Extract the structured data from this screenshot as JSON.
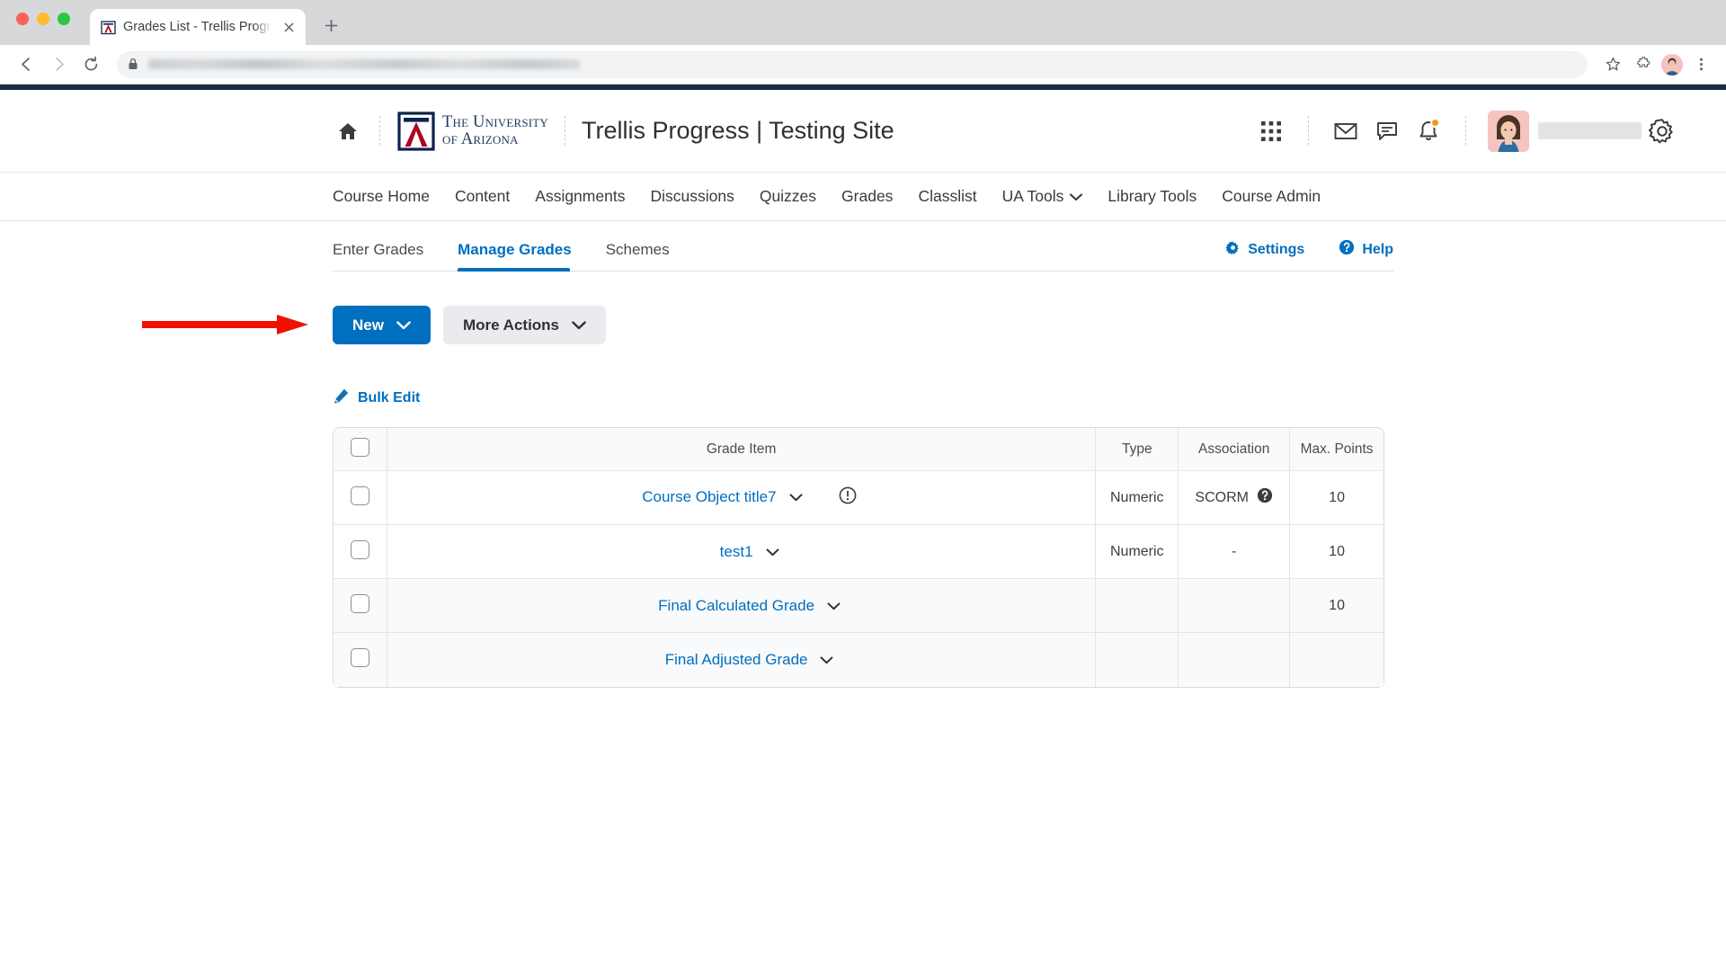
{
  "browser": {
    "tab_title": "Grades List - Trellis Progress |",
    "tab_favicon": "arizona-a-icon",
    "new_tab_label": "+",
    "close_label": "×",
    "back_icon": "back-arrow-icon",
    "forward_icon": "forward-arrow-icon",
    "reload_icon": "reload-icon",
    "lock_icon": "lock-icon",
    "url_value": "",
    "bookmark_icon": "star-icon",
    "extensions_icon": "puzzle-piece-icon",
    "profile_icon": "profile-avatar-icon",
    "menu_icon": "kebab-menu-icon",
    "window_menu_icon": "chevron-circle-icon"
  },
  "header": {
    "home_icon": "home-icon",
    "logo_line1": "The University",
    "logo_line2": "of Arizona",
    "site_title": "Trellis Progress | Testing Site",
    "icons": [
      {
        "name": "waffle-grid-icon",
        "label": "Course Selector"
      },
      {
        "name": "envelope-icon",
        "label": "Email"
      },
      {
        "name": "chat-icon",
        "label": "Chat"
      },
      {
        "name": "bell-icon",
        "label": "Notifications",
        "has_badge": true
      },
      {
        "name": "gear-icon",
        "label": "Settings"
      }
    ],
    "user_name": ""
  },
  "nav": {
    "items": [
      {
        "label": "Course Home",
        "has_chevron": false
      },
      {
        "label": "Content",
        "has_chevron": false
      },
      {
        "label": "Assignments",
        "has_chevron": false
      },
      {
        "label": "Discussions",
        "has_chevron": false
      },
      {
        "label": "Quizzes",
        "has_chevron": false
      },
      {
        "label": "Grades",
        "has_chevron": false
      },
      {
        "label": "Classlist",
        "has_chevron": false
      },
      {
        "label": "UA Tools",
        "has_chevron": true
      },
      {
        "label": "Library Tools",
        "has_chevron": false
      },
      {
        "label": "Course Admin",
        "has_chevron": false
      }
    ]
  },
  "tabs": {
    "items": [
      {
        "label": "Enter Grades",
        "active": false
      },
      {
        "label": "Manage Grades",
        "active": true
      },
      {
        "label": "Schemes",
        "active": false
      }
    ],
    "settings_label": "Settings",
    "settings_icon": "gear-icon",
    "help_label": "Help",
    "help_icon": "question-circle-icon",
    "accent_color": "#006fbf"
  },
  "annotation": {
    "arrow_color": "#f01000",
    "arrow_target": "Enter Grades"
  },
  "toolbar": {
    "new_label": "New",
    "new_chevron_icon": "chevron-down-icon",
    "more_actions_label": "More Actions",
    "more_actions_chevron_icon": "chevron-down-icon",
    "bulk_edit_label": "Bulk Edit",
    "bulk_edit_icon": "pencil-icon"
  },
  "table": {
    "columns": [
      "",
      "Grade Item",
      "Type",
      "Association",
      "Max. Points"
    ],
    "select_all_icon": "checkbox-icon",
    "rows": [
      {
        "name": "Course Object title7",
        "chevron_icon": "chevron-down-icon",
        "status_icon": "warning-circle-icon",
        "type": "Numeric",
        "association": "SCORM",
        "association_icon": "question-circle-icon",
        "max_points": "10"
      },
      {
        "name": "test1",
        "chevron_icon": "chevron-down-icon",
        "status_icon": "",
        "type": "Numeric",
        "association": "-",
        "association_icon": "",
        "max_points": "10"
      },
      {
        "name": "Final Calculated Grade",
        "chevron_icon": "chevron-down-icon",
        "status_icon": "",
        "type": "",
        "association": "",
        "association_icon": "",
        "max_points": "10"
      },
      {
        "name": "Final Adjusted Grade",
        "chevron_icon": "chevron-down-icon",
        "status_icon": "",
        "type": "",
        "association": "",
        "association_icon": "",
        "max_points": ""
      }
    ]
  }
}
